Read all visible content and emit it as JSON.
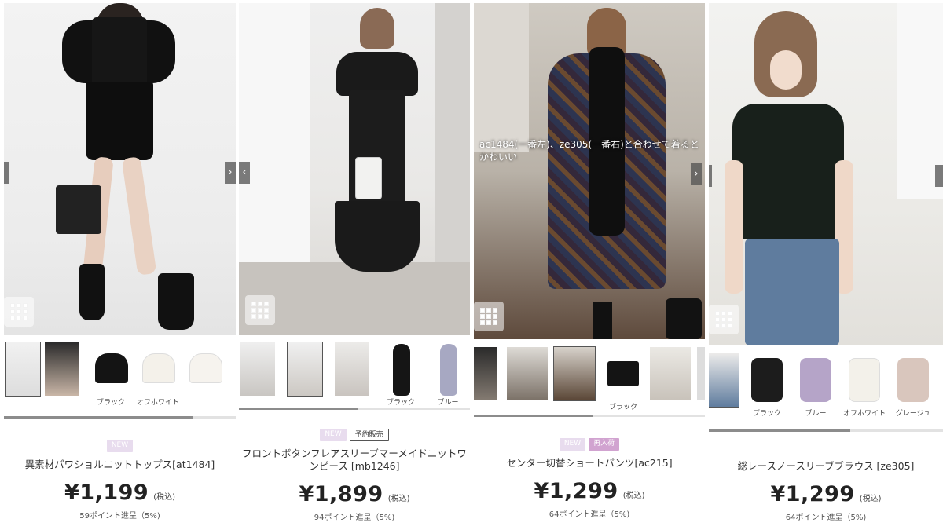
{
  "products": [
    {
      "badges": [
        "NEW"
      ],
      "name": "異素材パワショルニットトップス[at1484]",
      "price": "¥1,199",
      "tax": "(税込)",
      "points": "59ポイント進呈（5%)",
      "caption": "",
      "thumb_labels": [
        "",
        "",
        "ブラック",
        "オフホワイト",
        ""
      ]
    },
    {
      "badges": [
        "NEW",
        "予約販売"
      ],
      "name": "フロントボタンフレアスリーブマーメイドニットワンピース [mb1246]",
      "price": "¥1,899",
      "tax": "(税込)",
      "points": "94ポイント進呈（5%)",
      "caption": "",
      "thumb_labels": [
        "",
        "",
        "",
        "ブラック",
        "ブルー"
      ]
    },
    {
      "badges": [
        "NEW",
        "再入荷"
      ],
      "name": "センター切替ショートパンツ[ac215]",
      "price": "¥1,299",
      "tax": "(税込)",
      "points": "64ポイント進呈（5%)",
      "caption": "ac1484(一番左)、ze305(一番右)と合わせて着るとかわいい",
      "thumb_labels": [
        "",
        "",
        "",
        "ブラック",
        ""
      ]
    },
    {
      "badges": [],
      "name": "総レースノースリーブブラウス [ze305]",
      "price": "¥1,299",
      "tax": "(税込)",
      "points": "64ポイント進呈（5%)",
      "caption": "",
      "thumb_labels": [
        "",
        "ブラック",
        "ブルー",
        "オフホワイト",
        "グレージュ"
      ]
    }
  ],
  "colors": {
    "new_badge": "#e8dcee",
    "restock_badge": "#d1a3d0",
    "text": "#333333"
  },
  "icons": [
    "grid-view-icon",
    "chevron-left-icon",
    "chevron-right-icon"
  ]
}
